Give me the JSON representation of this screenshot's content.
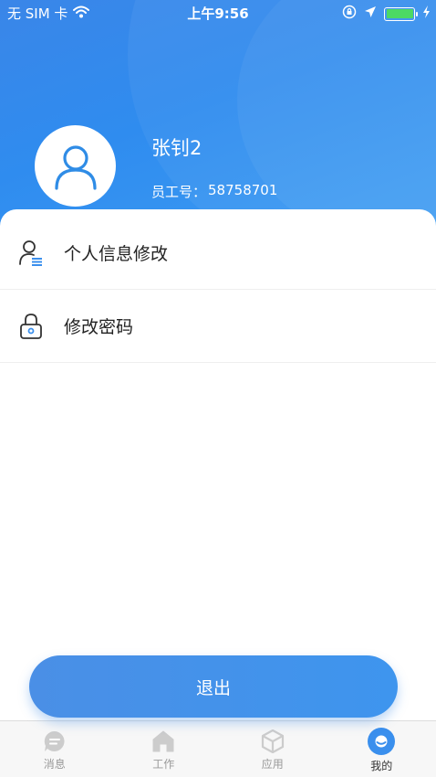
{
  "status_bar": {
    "carrier": "无 SIM 卡",
    "time": "上午9:56",
    "wifi_icon": "wifi-icon",
    "orientation_lock_icon": "orientation-lock-icon",
    "location_icon": "location-arrow-icon",
    "battery_icon": "battery-icon",
    "charging_icon": "charging-bolt-icon"
  },
  "profile": {
    "avatar_icon": "user-avatar-icon",
    "name": "张钊2",
    "employee_id_label": "员工号：",
    "employee_id": "58758701"
  },
  "menu": {
    "items": [
      {
        "label": "个人信息修改",
        "icon": "user-edit-icon"
      },
      {
        "label": "修改密码",
        "icon": "lock-icon"
      }
    ]
  },
  "logout_label": "退出",
  "tabbar": {
    "tabs": [
      {
        "label": "消息",
        "icon": "message-icon",
        "active": false
      },
      {
        "label": "工作",
        "icon": "home-icon",
        "active": false
      },
      {
        "label": "应用",
        "icon": "cube-icon",
        "active": false
      },
      {
        "label": "我的",
        "icon": "profile-icon",
        "active": true
      }
    ]
  },
  "colors": {
    "primary": "#3a8fed",
    "battery": "#4cd964",
    "tab_inactive": "#cccccc"
  }
}
